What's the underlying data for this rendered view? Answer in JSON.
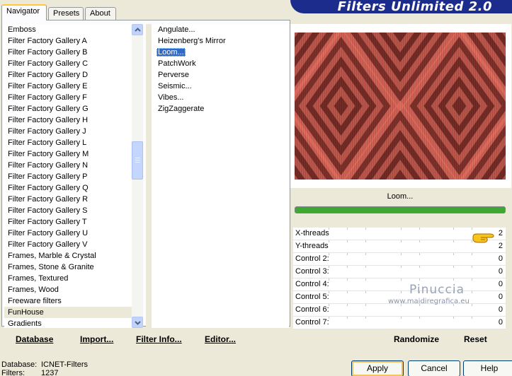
{
  "tabs": [
    "Navigator",
    "Presets",
    "About"
  ],
  "banner_title": "Filters Unlimited 2.0",
  "categories": [
    "Emboss",
    "Filter Factory Gallery A",
    "Filter Factory Gallery B",
    "Filter Factory Gallery C",
    "Filter Factory Gallery D",
    "Filter Factory Gallery E",
    "Filter Factory Gallery F",
    "Filter Factory Gallery G",
    "Filter Factory Gallery H",
    "Filter Factory Gallery J",
    "Filter Factory Gallery L",
    "Filter Factory Gallery M",
    "Filter Factory Gallery N",
    "Filter Factory Gallery P",
    "Filter Factory Gallery Q",
    "Filter Factory Gallery R",
    "Filter Factory Gallery S",
    "Filter Factory Gallery T",
    "Filter Factory Gallery U",
    "Filter Factory Gallery V",
    "Frames, Marble & Crystal",
    "Frames, Stone & Granite",
    "Frames, Textured",
    "Frames, Wood",
    "Freeware filters",
    "FunHouse",
    "Gradients"
  ],
  "selected_category": "FunHouse",
  "filters": [
    "Angulate...",
    "Heizenberg's Mirror",
    "Loom...",
    "PatchWork",
    "Perverse",
    "Seismic...",
    "Vibes...",
    "ZigZaggerate"
  ],
  "selected_filter": "Loom...",
  "bottom_links": {
    "database": "Database",
    "import": "Import...",
    "filter_info": "Filter Info...",
    "editor": "Editor..."
  },
  "preview": {
    "filter_name": "Loom...",
    "progress": 1.0,
    "colors": {
      "dark": "#3a0a08",
      "mid": "#a8463e",
      "light": "#f07868"
    }
  },
  "controls": [
    {
      "label": "X-threads",
      "value": "2"
    },
    {
      "label": "Y-threads",
      "value": "2"
    },
    {
      "label": "Control 2:",
      "value": "0"
    },
    {
      "label": "Control 3:",
      "value": "0"
    },
    {
      "label": "Control 4:",
      "value": "0"
    },
    {
      "label": "Control 5:",
      "value": "0"
    },
    {
      "label": "Control 6:",
      "value": "0"
    },
    {
      "label": "Control 7:",
      "value": "0"
    }
  ],
  "watermark": {
    "name": "Pinuccia",
    "url": "www.maidiregrafica.eu"
  },
  "right_links": {
    "randomize": "Randomize",
    "reset": "Reset"
  },
  "status": {
    "database_label": "Database:",
    "database_value": "ICNET-Filters",
    "filters_label": "Filters:",
    "filters_value": "1237"
  },
  "buttons": {
    "apply": "Apply",
    "cancel": "Cancel",
    "help": "Help"
  },
  "icons": {
    "scroll_up": "chevron-up-icon",
    "scroll_down": "chevron-down-icon",
    "pointer": "pointing-hand-icon"
  },
  "accent_colors": {
    "banner": "#1c2c8c",
    "selection": "#316ac5",
    "tab_highlight": "#ffc83c"
  }
}
